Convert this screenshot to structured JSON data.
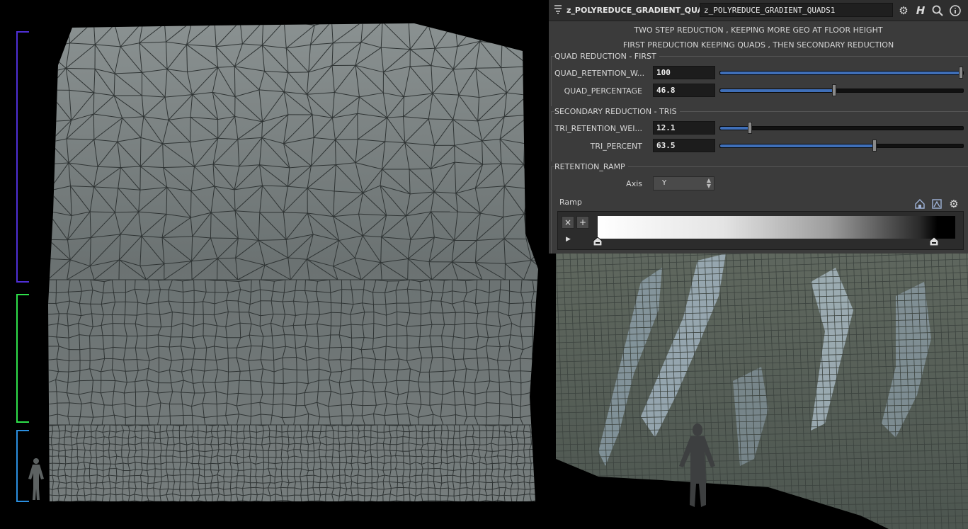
{
  "node": {
    "type": "z_POLYREDUCE_GRADIENT_QUADS",
    "name": "z_POLYREDUCE_GRADIENT_QUADS1"
  },
  "toolbar_icons": [
    "gear-icon",
    "houdini-help-icon",
    "search-icon",
    "info-icon"
  ],
  "description": {
    "line1": "TWO STEP REDUCTION , KEEPING MORE GEO AT FLOOR HEIGHT",
    "line2": "FIRST PREDUCTION KEEPING QUADS , THEN SECONDARY REDUCTION"
  },
  "folders": {
    "quad": {
      "label": "QUAD REDUCTION - FIRST",
      "params": [
        {
          "label": "QUAD_RETENTION_W...",
          "value": "100",
          "fraction": 1.0
        },
        {
          "label": "QUAD_PERCENTAGE",
          "value": "46.8",
          "fraction": 0.468
        }
      ]
    },
    "tris": {
      "label": "SECONDARY REDUCTION - TRIS",
      "params": [
        {
          "label": "TRI_RETENTION_WEI...",
          "value": "12.1",
          "fraction": 0.121
        },
        {
          "label": "TRI_PERCENT",
          "value": "63.5",
          "fraction": 0.635
        }
      ]
    },
    "ramp": {
      "label": "RETENTION_RAMP",
      "axis_label": "Axis",
      "axis_value": "Y",
      "ramp_label": "Ramp",
      "remove_symbol": "×",
      "add_symbol": "+",
      "keys": [
        0.0,
        0.94
      ]
    }
  },
  "colors": {
    "bracket_top": "#4f2fd6",
    "bracket_mid": "#2ee04a",
    "bracket_low": "#2b8fe0",
    "slider_fill": "#3f6fb8",
    "mesh_fill": "#7d8484",
    "mesh_line": "#2f3434"
  }
}
